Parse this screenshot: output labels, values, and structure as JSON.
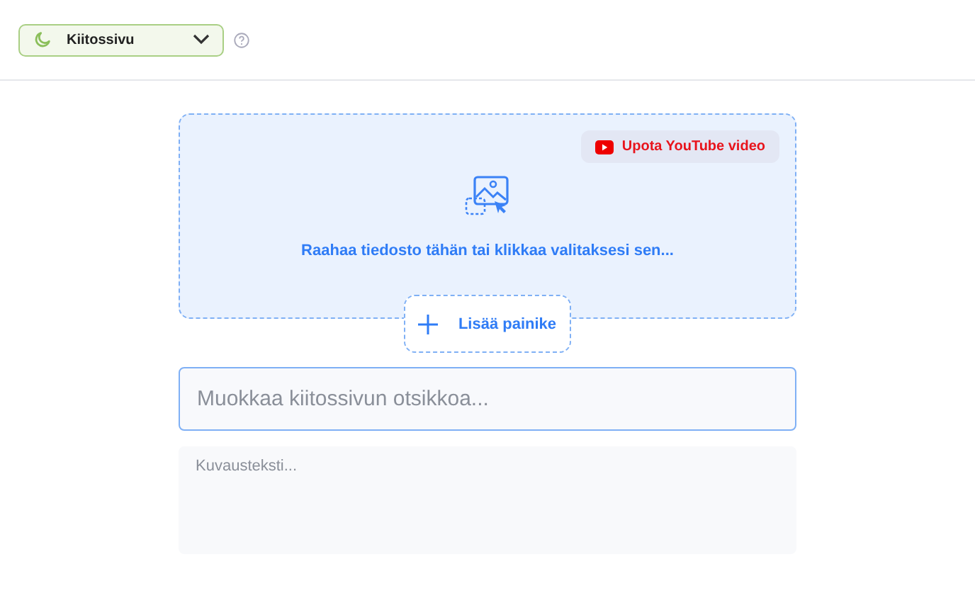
{
  "page_selector": {
    "label": "Kiitossivu"
  },
  "dropzone": {
    "embed_button": "Upota YouTube video",
    "hint": "Raahaa tiedosto tähän tai klikkaa valitaksesi sen..."
  },
  "add_button": {
    "label": "Lisää painike"
  },
  "title_field": {
    "placeholder": "Muokkaa kiitossivun otsikkoa...",
    "focused": true
  },
  "description_field": {
    "placeholder": "Kuvausteksti..."
  }
}
